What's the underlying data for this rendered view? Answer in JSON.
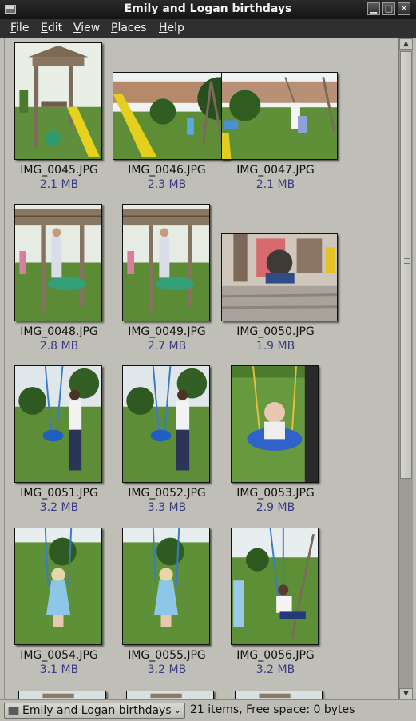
{
  "window": {
    "title": "Emily and Logan birthdays",
    "minimize": "▁",
    "maximize": "□",
    "close": "✕"
  },
  "menu": [
    {
      "label": "File",
      "mnemonic": "F"
    },
    {
      "label": "Edit",
      "mnemonic": "E"
    },
    {
      "label": "View",
      "mnemonic": "V"
    },
    {
      "label": "Places",
      "mnemonic": "P"
    },
    {
      "label": "Help",
      "mnemonic": "H"
    }
  ],
  "files": [
    {
      "name": "IMG_0045.JPG",
      "size": "2.1 MB",
      "orientation": "portrait",
      "scene": "playset-slide"
    },
    {
      "name": "IMG_0046.JPG",
      "size": "2.3 MB",
      "orientation": "landscape",
      "scene": "slide-yard"
    },
    {
      "name": "IMG_0047.JPG",
      "size": "2.1 MB",
      "orientation": "landscape",
      "scene": "swing-yard"
    },
    {
      "name": "IMG_0048.JPG",
      "size": "2.8 MB",
      "orientation": "portrait",
      "scene": "monkey-bars"
    },
    {
      "name": "IMG_0049.JPG",
      "size": "2.7 MB",
      "orientation": "portrait",
      "scene": "monkey-bars"
    },
    {
      "name": "IMG_0050.JPG",
      "size": "1.9 MB",
      "orientation": "landscape",
      "scene": "boy-playhouse"
    },
    {
      "name": "IMG_0051.JPG",
      "size": "3.2 MB",
      "orientation": "portrait",
      "scene": "baby-swing"
    },
    {
      "name": "IMG_0052.JPG",
      "size": "3.3 MB",
      "orientation": "portrait",
      "scene": "baby-swing"
    },
    {
      "name": "IMG_0053.JPG",
      "size": "2.9 MB",
      "orientation": "portrait",
      "scene": "baby-swing-close"
    },
    {
      "name": "IMG_0054.JPG",
      "size": "3.1 MB",
      "orientation": "portrait",
      "scene": "girl-swing"
    },
    {
      "name": "IMG_0055.JPG",
      "size": "3.2 MB",
      "orientation": "portrait",
      "scene": "girl-swing"
    },
    {
      "name": "IMG_0056.JPG",
      "size": "3.2 MB",
      "orientation": "portrait",
      "scene": "two-girls-swing"
    }
  ],
  "status": {
    "location": "Emily and Logan birthdays",
    "summary": "21 items, Free space: 0 bytes"
  },
  "scroll": {
    "position_fraction": 0.0,
    "visible_fraction": 0.66
  },
  "colors": {
    "size_text": "#3a3a85",
    "window_bg": "#bdbdb5",
    "titlebar": "#1e1e1e"
  }
}
